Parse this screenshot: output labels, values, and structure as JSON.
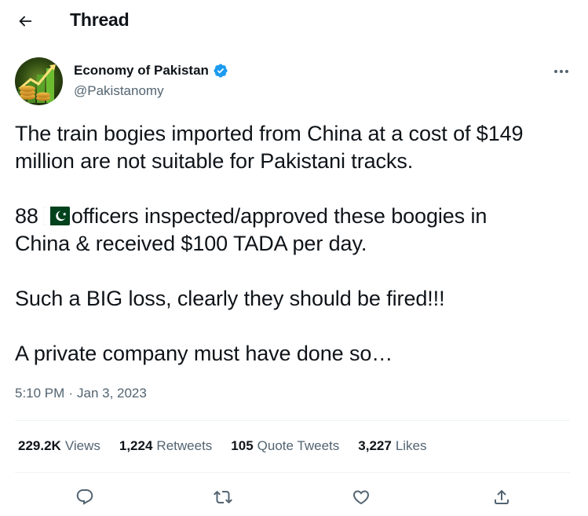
{
  "header": {
    "title": "Thread"
  },
  "author": {
    "display_name": "Economy of Pakistan",
    "handle": "@Pakistanomy",
    "verified": true
  },
  "tweet": {
    "lines": [
      "The train bogies imported from China at a cost of $149",
      "million are not suitable for Pakistani tracks.",
      "88",
      "officers inspected/approved these boogies in",
      "China & received $100 TADA per day.",
      "Such a BIG loss, clearly they should be fired!!!",
      "A private company must have done so…"
    ],
    "flag_emoji": "pakistan-flag-icon"
  },
  "meta": {
    "time": "5:10 PM",
    "separator": "·",
    "date": "Jan 3, 2023"
  },
  "stats": {
    "views_count": "229.2K",
    "views_label": "Views",
    "retweets_count": "1,224",
    "retweets_label": "Retweets",
    "quotes_count": "105",
    "quotes_label": "Quote Tweets",
    "likes_count": "3,227",
    "likes_label": "Likes"
  },
  "colors": {
    "text": "#0f1419",
    "secondary": "#536471",
    "verified": "#1d9bf0",
    "divider": "#eff3f4"
  }
}
